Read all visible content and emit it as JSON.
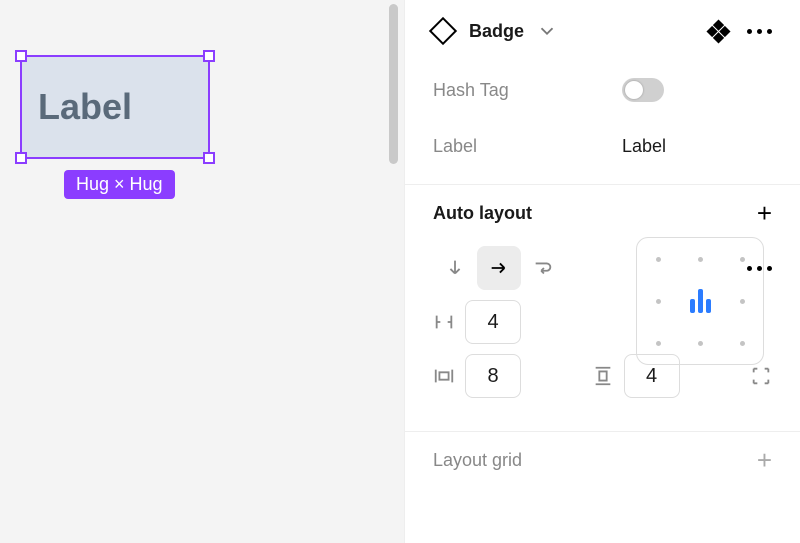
{
  "canvas": {
    "frame_text": "Label",
    "size_badge": "Hug × Hug"
  },
  "header": {
    "component_name": "Badge"
  },
  "props": {
    "hash_tag": {
      "name": "Hash Tag",
      "value": false
    },
    "label": {
      "name": "Label",
      "value": "Label"
    }
  },
  "sections": {
    "auto_layout": "Auto layout",
    "layout_grid": "Layout grid"
  },
  "auto_layout": {
    "direction": "horizontal",
    "gap": "4",
    "h_padding": "8",
    "v_padding": "4"
  }
}
